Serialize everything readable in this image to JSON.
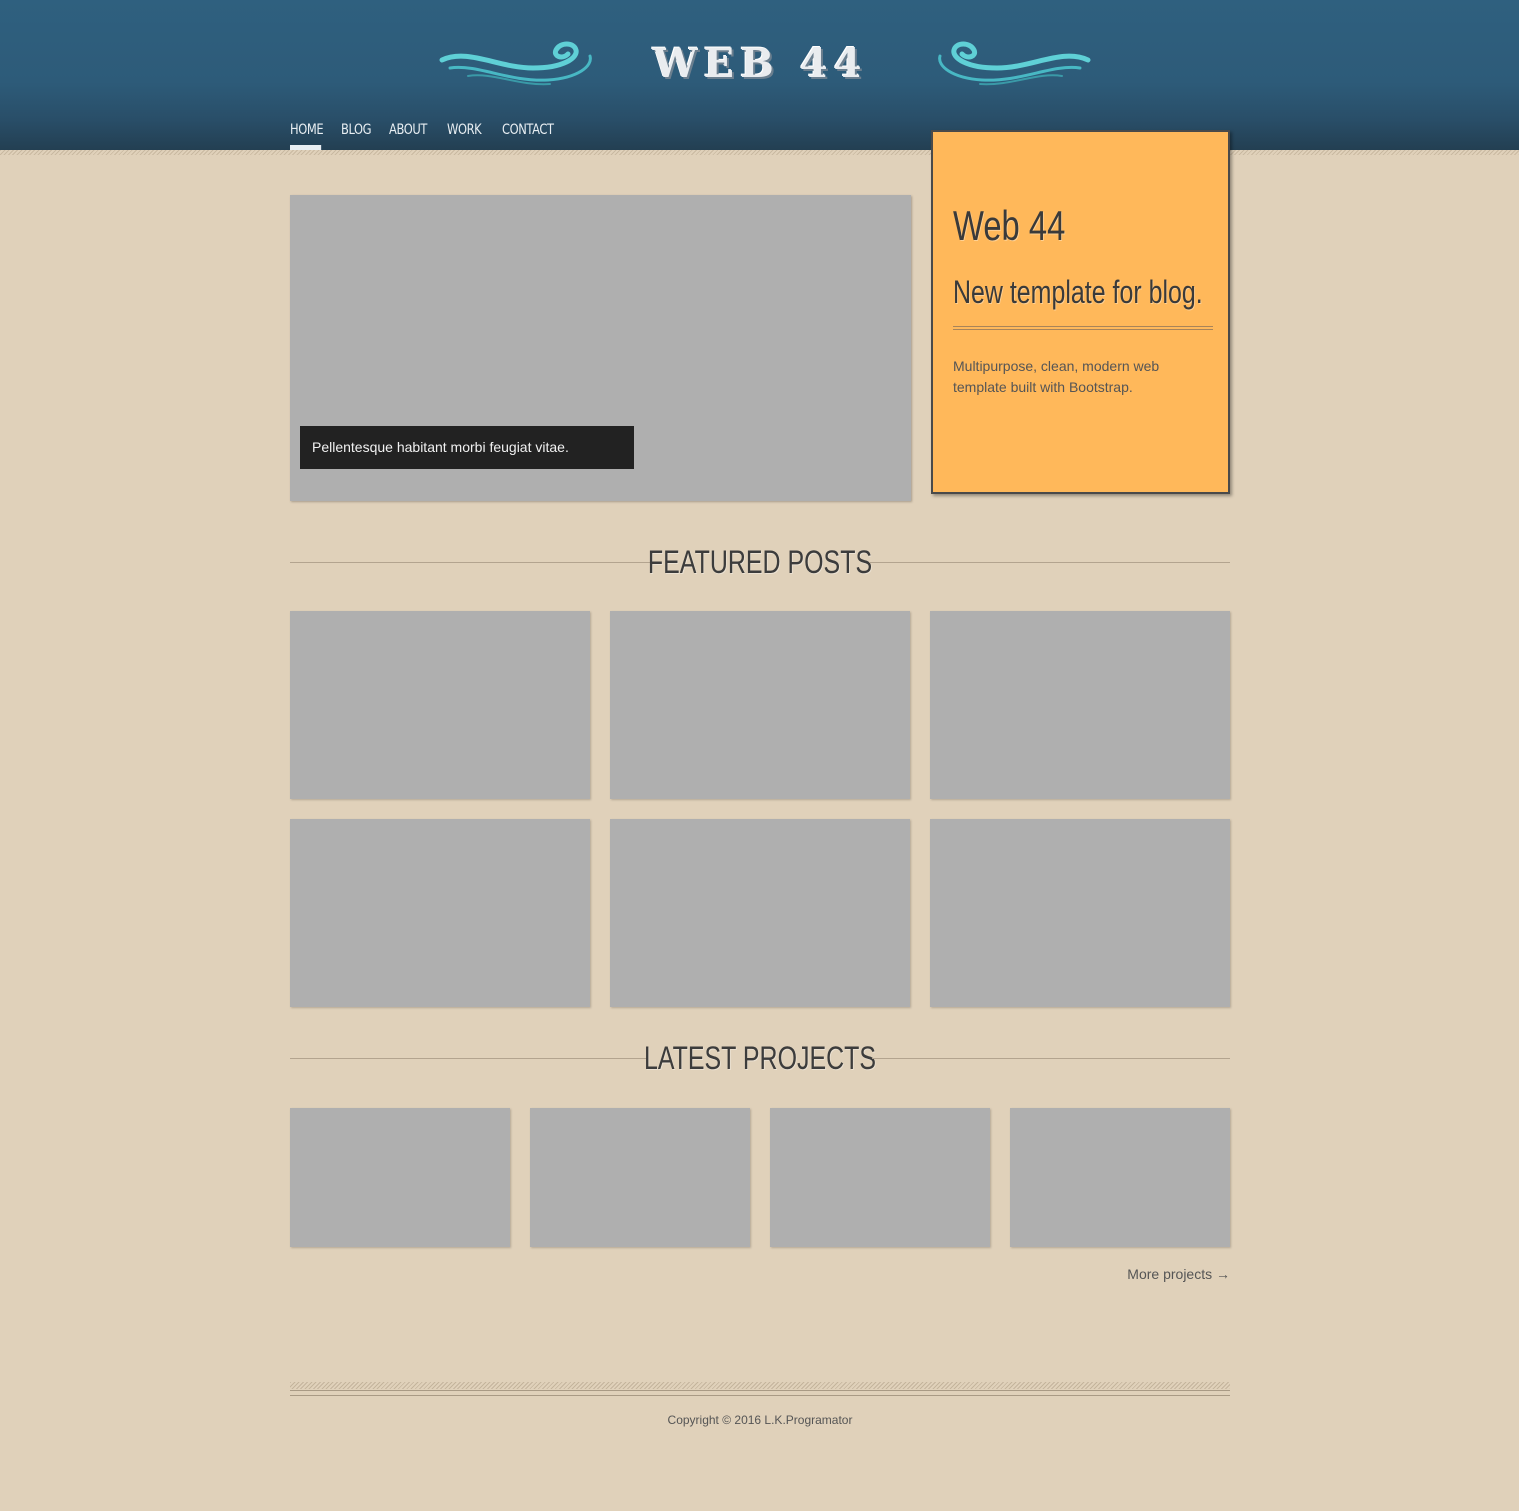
{
  "brand": {
    "logo_text": "WEB 44"
  },
  "nav": {
    "items": [
      {
        "label": "HOME",
        "active": true
      },
      {
        "label": "BLOG",
        "active": false
      },
      {
        "label": "ABOUT",
        "active": false
      },
      {
        "label": "WORK",
        "active": false
      },
      {
        "label": "CONTACT",
        "active": false
      }
    ]
  },
  "slider": {
    "caption": "Pellentesque habitant morbi feugiat vitae."
  },
  "promo": {
    "title": "Web 44",
    "subtitle": "New template for blog.",
    "text": "Multipurpose, clean, modern web template built with Bootstrap."
  },
  "featured": {
    "heading": "FEATURED POSTS",
    "count": 6
  },
  "projects": {
    "heading": "LATEST PROJECTS",
    "count": 4,
    "more_link": "More projects →"
  },
  "footer": {
    "copyright": "Copyright © 2016 L.K.Programator"
  },
  "colors": {
    "header": "#2f607f",
    "background": "#e0d1ba",
    "promo": "#ffb85a",
    "placeholder": "#afafaf",
    "swirl": "#5fd0d6"
  }
}
